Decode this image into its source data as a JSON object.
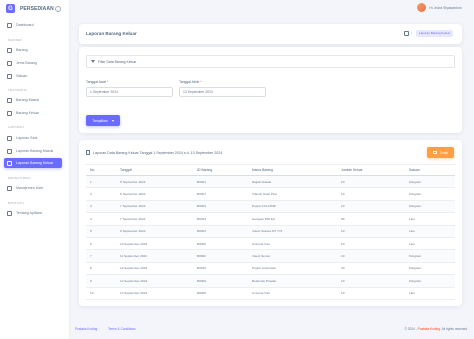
{
  "app": {
    "logo_letter": "G",
    "name": "PERSEDIAAN",
    "toggle_icon": "chevron-left-icon"
  },
  "sidebar": {
    "sections": [
      {
        "label": "MASTER",
        "items": [
          {
            "label": "Barang",
            "icon": "box-icon"
          },
          {
            "label": "Jenis Barang",
            "icon": "tag-icon"
          },
          {
            "label": "Satuan",
            "icon": "ruler-icon"
          }
        ]
      },
      {
        "label": "TRANSAKSI",
        "items": [
          {
            "label": "Barang Masuk",
            "icon": "arrow-in-icon"
          },
          {
            "label": "Barang Keluar",
            "icon": "arrow-out-icon"
          }
        ]
      },
      {
        "label": "LAPORAN",
        "items": [
          {
            "label": "Laporan Stok",
            "icon": "report-icon"
          },
          {
            "label": "Laporan Barang Masuk",
            "icon": "report-in-icon"
          },
          {
            "label": "Laporan Barang Keluar",
            "icon": "report-out-icon",
            "active": true
          }
        ]
      },
      {
        "label": "PENGATURAN",
        "items": [
          {
            "label": "Manajemen User",
            "icon": "users-icon"
          }
        ]
      },
      {
        "label": "BANTUAN",
        "items": [
          {
            "label": "Tentang Aplikasi",
            "icon": "info-icon"
          }
        ]
      }
    ],
    "dashboard": {
      "label": "Dashboard",
      "icon": "home-icon"
    }
  },
  "navbar": {
    "greeting": "Hi, Indra Styawantoro"
  },
  "header": {
    "title": "Laporan Barang Keluar",
    "breadcrumb_active": "Laporan Barang Keluar"
  },
  "filter": {
    "title": "Filter Data Barang Keluar",
    "start_label": "Tanggal Awal",
    "end_label": "Tanggal Akhir",
    "start_value": "1 September 2024",
    "end_value": "13 September 2024",
    "show_button": "Tampilkan"
  },
  "report": {
    "title": "Laporan Data Barang Keluar Tanggal 1 September 2024 s.d. 13 September 2024",
    "print_button": "Cetak",
    "columns": [
      "No.",
      "Tanggal",
      "ID Barang",
      "Nama Barang",
      "Jumlah Keluar",
      "Satuan"
    ],
    "rows": [
      [
        "1",
        "5 September 2024",
        "B0001",
        "Rajiah Rukale",
        "10",
        "Kilogram"
      ],
      [
        "2",
        "5 September 2024",
        "B0007",
        "Vitamin Kalel Plus",
        "10",
        "Kilogram"
      ],
      [
        "3",
        "7 September 2024",
        "B0003",
        "Pupuk KCLAHSP",
        "10",
        "Kilogram"
      ],
      [
        "4",
        "7 September 2024",
        "B0004",
        "Gerapan 500 EC",
        "90",
        "Liter"
      ],
      [
        "5",
        "9 September 2024",
        "B0003",
        "Insect Sukses PX 772",
        "10",
        "Liter"
      ],
      [
        "6",
        "10 September 2024",
        "B0005",
        "Ammina Cair",
        "10",
        "Liter"
      ],
      [
        "7",
        "11 September 2024",
        "B0002",
        "Insect Semut",
        "10",
        "Kilogram"
      ],
      [
        "8",
        "12 September 2024",
        "B0010",
        "Pupuk Gosumida",
        "30",
        "Kilogram"
      ],
      [
        "9",
        "12 September 2024",
        "B0009",
        "Betamaty Powder",
        "10",
        "Kilogram"
      ],
      [
        "10",
        "13 September 2024",
        "B0005",
        "Ammina Cair",
        "10",
        "Liter"
      ]
    ]
  },
  "footer": {
    "link1": "Pustaka Koding",
    "link2": "Terms & Conditions",
    "copy_prefix": "© 2024 - ",
    "copy_brand": "Pustaka Koding",
    "copy_suffix": ". All rights reserved."
  },
  "colors": {
    "accent": "#696cff",
    "warning": "#ff9f43"
  }
}
